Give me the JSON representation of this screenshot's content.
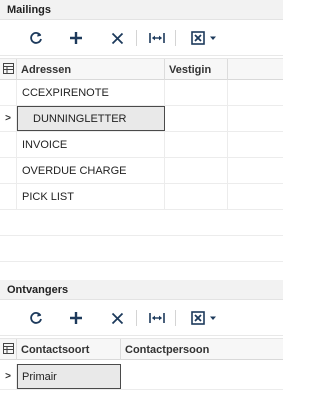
{
  "mailings": {
    "title": "Mailings",
    "columns": [
      "Adressen",
      "Vestigin"
    ],
    "rows": [
      {
        "adres": "CCEXPIRENOTE",
        "vestiging": "",
        "selected": false
      },
      {
        "adres": "DUNNINGLETTER",
        "vestiging": "",
        "selected": true
      },
      {
        "adres": "INVOICE",
        "vestiging": "",
        "selected": false
      },
      {
        "adres": "OVERDUE CHARGE",
        "vestiging": "",
        "selected": false
      },
      {
        "adres": "PICK LIST",
        "vestiging": "",
        "selected": false
      }
    ]
  },
  "ontvangers": {
    "title": "Ontvangers",
    "columns": [
      "Contactsoort",
      "Contactpersoon"
    ],
    "rows": [
      {
        "contactsoort": "Primair",
        "contactpersoon": "",
        "selected": true
      }
    ]
  },
  "toolbar_icons": [
    "refresh-icon",
    "add-icon",
    "delete-icon",
    "fit-columns-icon",
    "excel-export-icon",
    "chevron-down-icon"
  ],
  "colors": {
    "icon": "#1d3a5c",
    "header_bg": "#f2f2f2",
    "selected_bg": "#e9e9e9"
  }
}
